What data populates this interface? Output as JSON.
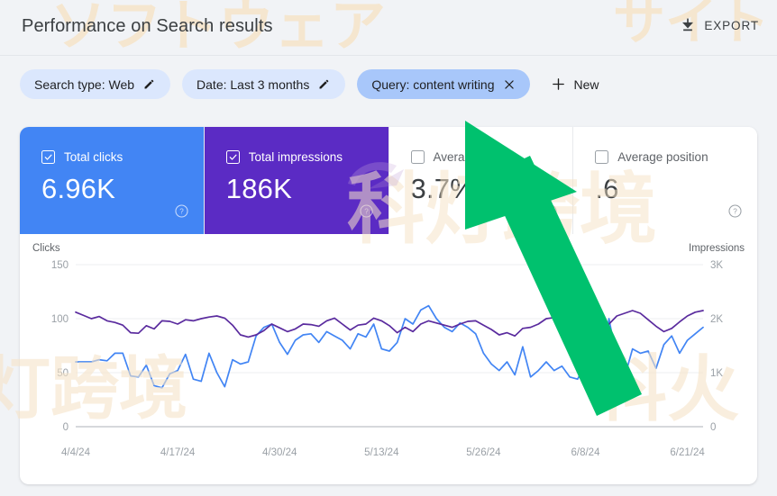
{
  "header": {
    "title": "Performance on Search results",
    "export_label": "EXPORT",
    "export_icon": "download-icon"
  },
  "filters": {
    "chips": [
      {
        "label": "Search type: Web",
        "icon": "pencil-icon",
        "active": false
      },
      {
        "label": "Date: Last 3 months",
        "icon": "pencil-icon",
        "active": false
      },
      {
        "label": "Query: content writing",
        "icon": "close-icon",
        "active": true
      }
    ],
    "new_label": "New",
    "new_icon": "plus-icon"
  },
  "metrics": [
    {
      "label": "Total clicks",
      "value": "6.96K",
      "checked": true,
      "color": "#4285f4",
      "help_icon": "help-icon"
    },
    {
      "label": "Total impressions",
      "value": "186K",
      "checked": true,
      "color": "#5b2bc4",
      "help_icon": "help-icon"
    },
    {
      "label": "Average CTR",
      "value": "3.7%",
      "checked": false,
      "color": "#ffffff",
      "help_icon": "help-icon"
    },
    {
      "label": "Average position",
      "value": ".6",
      "checked": false,
      "color": "#ffffff",
      "help_icon": "help-icon"
    }
  ],
  "watermarks": {
    "top_left": "ソフトウェア",
    "top_right": "サイト",
    "center": "科灯跨境",
    "left": "灯跨境",
    "right": "科火"
  },
  "chart_data": {
    "type": "line",
    "title": "",
    "xlabel": "",
    "ylabel": "Clicks",
    "y2label": "Impressions",
    "ylim": [
      0,
      150
    ],
    "y2lim": [
      0,
      3000
    ],
    "yticks": [
      "0",
      "50",
      "100",
      "150"
    ],
    "y2ticks": [
      "0",
      "1K",
      "2K",
      "3K"
    ],
    "grid": true,
    "legend": "none",
    "x_tick_labels": [
      "4/4/24",
      "4/17/24",
      "4/30/24",
      "5/13/24",
      "5/26/24",
      "6/8/24",
      "6/21/24"
    ],
    "series": [
      {
        "name": "Clicks",
        "color": "#4285f4",
        "axis": "left",
        "values": [
          60,
          60,
          60,
          62,
          61,
          68,
          68,
          47,
          46,
          57,
          38,
          36,
          49,
          52,
          67,
          44,
          42,
          68,
          50,
          37,
          62,
          58,
          60,
          84,
          92,
          95,
          78,
          67,
          80,
          85,
          86,
          78,
          88,
          84,
          80,
          72,
          86,
          83,
          95,
          72,
          70,
          78,
          100,
          95,
          108,
          112,
          100,
          92,
          88,
          96,
          92,
          86,
          68,
          58,
          52,
          60,
          48,
          74,
          46,
          52,
          60,
          52,
          56,
          46,
          44,
          58,
          52,
          50,
          100,
          62,
          46,
          72,
          68,
          70,
          54,
          76,
          84,
          68,
          80,
          86,
          92
        ]
      },
      {
        "name": "Impressions",
        "color": "#5a2b9e",
        "axis": "right",
        "values": [
          2120,
          2060,
          2000,
          2040,
          1960,
          1930,
          1880,
          1740,
          1730,
          1870,
          1810,
          1960,
          1950,
          1900,
          1980,
          1960,
          2000,
          2030,
          2050,
          2010,
          1880,
          1700,
          1660,
          1700,
          1780,
          1900,
          1830,
          1760,
          1810,
          1900,
          1890,
          1860,
          1960,
          2010,
          1900,
          1790,
          1880,
          1900,
          2010,
          1960,
          1870,
          1740,
          1840,
          1760,
          1900,
          1960,
          1920,
          1880,
          1840,
          1900,
          1950,
          1960,
          1880,
          1800,
          1700,
          1740,
          1680,
          1820,
          1840,
          1900,
          2000,
          2020,
          1960,
          1900,
          1760,
          1660,
          1640,
          1700,
          1900,
          2050,
          2100,
          2150,
          2100,
          1980,
          1860,
          1760,
          1820,
          1940,
          2050,
          2120,
          2150
        ]
      }
    ]
  },
  "arrow": {
    "name": "green-cursor-arrow",
    "color": "#00c16e"
  }
}
